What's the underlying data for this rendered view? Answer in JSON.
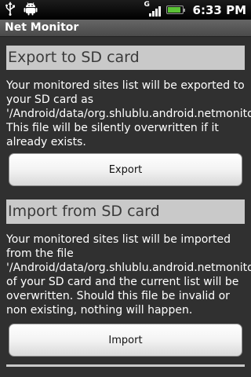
{
  "status_bar": {
    "icons_left": [
      "usb-icon",
      "android-debug-icon"
    ],
    "network_letter": "G",
    "signal_bars": 4,
    "battery_level": 0.9,
    "time": "6:33 PM"
  },
  "app": {
    "title": "Net Monitor"
  },
  "export_section": {
    "header": "Export to SD card",
    "description": "Your monitored sites list will be exported to your SD card as '/Android/data/org.shlublu.android.netmonitor/sites.xml'. This file will be silently overwritten if it already exists.",
    "button_label": "Export"
  },
  "import_section": {
    "header": "Import from SD card",
    "description": "Your monitored sites list will be imported from the file '/Android/data/org.shlublu.android.netmonitor/sites.xml' of your SD card and the current list will be overwritten. Should this file be invalid or non existing, nothing will happen.",
    "button_label": "Import"
  },
  "colors": {
    "background": "#303030",
    "section_header": "#c9c9c9",
    "battery": "#5bc236"
  }
}
